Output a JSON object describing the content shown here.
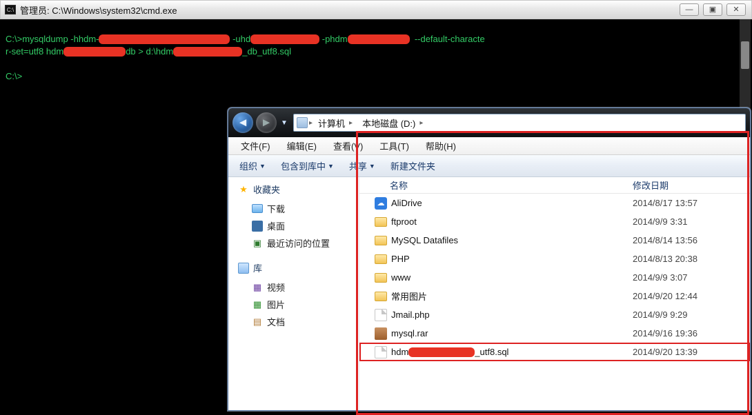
{
  "cmd": {
    "title": "管理员: C:\\Windows\\system32\\cmd.exe",
    "icon_label": "C:\\",
    "prompt1": "C:\\>",
    "command_parts": {
      "p1": "mysqldump -hhdm-",
      "p2": " -uhd",
      "p3": " -phdm",
      "p4": "  --default-characte",
      "line2a": "r-set=utf8 hdm",
      "line2b": "db > d:\\hdm",
      "line2c": "_db_utf8.sql"
    },
    "prompt2": "C:\\>"
  },
  "win_buttons": {
    "min": "—",
    "max": "▣",
    "close": "✕"
  },
  "explorer": {
    "breadcrumb": {
      "seg1": "计算机",
      "seg2": "本地磁盘 (D:)"
    },
    "menu": {
      "file": "文件(F)",
      "edit": "编辑(E)",
      "view": "查看(V)",
      "tools": "工具(T)",
      "help": "帮助(H)"
    },
    "toolbar": {
      "organize": "组织",
      "include": "包含到库中",
      "share": "共享",
      "newfolder": "新建文件夹"
    },
    "nav": {
      "favorites": "收藏夹",
      "downloads": "下载",
      "desktop": "桌面",
      "recent": "最近访问的位置",
      "libraries": "库",
      "video": "视频",
      "pictures": "图片",
      "documents": "文档"
    },
    "columns": {
      "name": "名称",
      "date": "修改日期"
    },
    "rows": [
      {
        "icon": "cloud",
        "name": "AliDrive",
        "date": "2014/8/17 13:57"
      },
      {
        "icon": "folder",
        "name": "ftproot",
        "date": "2014/9/9 3:31"
      },
      {
        "icon": "folder",
        "name": "MySQL Datafiles",
        "date": "2014/8/14 13:56"
      },
      {
        "icon": "folder",
        "name": "PHP",
        "date": "2014/8/13 20:38"
      },
      {
        "icon": "folder",
        "name": "www",
        "date": "2014/9/9 3:07"
      },
      {
        "icon": "folder",
        "name": "常用图片",
        "date": "2014/9/20 12:44"
      },
      {
        "icon": "file",
        "name": "Jmail.php",
        "date": "2014/9/9 9:29"
      },
      {
        "icon": "rar",
        "name": "mysql.rar",
        "date": "2014/9/16 19:36"
      },
      {
        "icon": "file",
        "name_prefix": "hdm",
        "name_suffix": "_utf8.sql",
        "date": "2014/9/20 13:39",
        "highlight": true,
        "redact": true
      }
    ]
  }
}
